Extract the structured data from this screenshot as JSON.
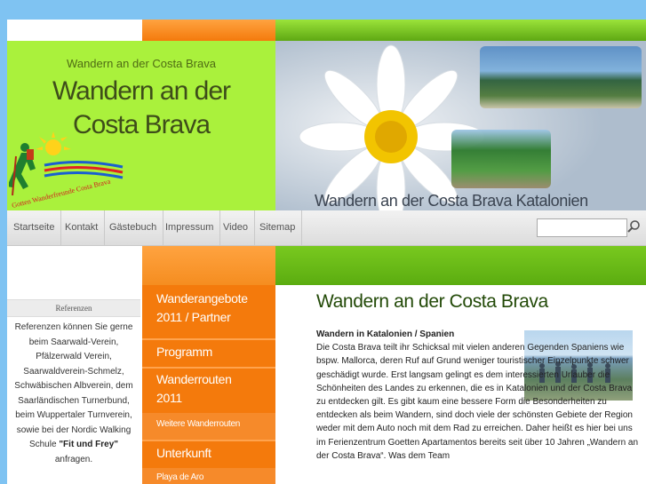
{
  "colors": {
    "lime": "#aaf13c",
    "orange": "#f47a0c",
    "green": "#5bac10",
    "sky": "#7fc3f2"
  },
  "header": {
    "subtitle": "Wandern an der Costa Brava",
    "title_line1": "Wandern an der",
    "title_line2": "Costa Brava",
    "logo_text": "Gotten Wanderfreunde Costa Brava",
    "image_caption": "Wandern an der Costa Brava Katalonien"
  },
  "nav": {
    "items": [
      "Startseite",
      "Kontakt",
      "Gästebuch",
      "Impressum",
      "Video",
      "Sitemap"
    ],
    "search_placeholder": "",
    "search_icon": "search-icon"
  },
  "sidebar": {
    "heading": "Referenzen",
    "text_before": "Referenzen können Sie gerne beim Saarwald-Verein, Pfälzerwald Verein, Saarwaldverein-Schmelz, Schwäbischen Albverein, dem Saarländischen Turnerbund, beim Wuppertaler Turnverein, sowie bei der Nordic Walking Schule ",
    "text_bold": "\"Fit und Frey\"",
    "text_after": " anfragen."
  },
  "menu": {
    "items": [
      {
        "label_line1": "Wanderangebote",
        "label_line2": "2011 / Partner"
      },
      {
        "label_line1": "Programm"
      },
      {
        "label_line1": "Wanderrouten",
        "label_line2": "2011"
      },
      {
        "label_line1": "Weitere Wanderrouten"
      },
      {
        "label_line1": "Unterkunft"
      },
      {
        "label_line1": "Playa de Aro"
      }
    ]
  },
  "content": {
    "title": "Wandern an der Costa Brava",
    "bold_intro": "Wandern in Katalonien / Spanien",
    "body": "Die Costa Brava teilt ihr Schicksal mit vielen anderen Gegenden Spaniens wie bspw. Mallorca, deren Ruf auf Grund weniger touristischer Einzelpunkte schwer geschädigt wurde. Erst langsam gelingt es dem interessierten Urlauber die Schönheiten des Landes zu erkennen, die es in Katalonien und der Costa Brava zu entdecken gilt. Es gibt kaum eine bessere Form die Besonderheiten zu entdecken als beim Wandern, sind doch viele der schönsten Gebiete der Region weder mit dem Auto noch mit dem Rad zu erreichen. Daher heißt es hier bei uns im Ferienzentrum Goetten Apartamentos bereits seit über 10 Jahren „Wandern an der Costa Brava“. Was dem Team"
  }
}
